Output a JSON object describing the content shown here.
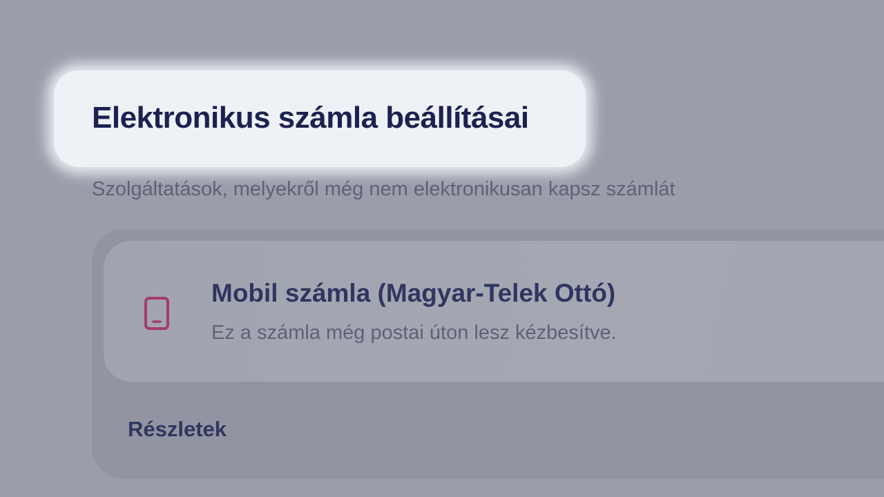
{
  "header": {
    "title": "Elektronikus számla beállításai",
    "subtitle": "Szolgáltatások, melyekről még nem elektronikusan kapsz számlát"
  },
  "service_card": {
    "icon": "mobile-phone-icon",
    "title": "Mobil számla (Magyar-Telek Ottó)",
    "description": "Ez a számla még postai úton lesz kézbesítve.",
    "details_label": "Részletek"
  },
  "colors": {
    "title": "#1b2150",
    "accent_icon": "#a33c6d",
    "highlight": "#eef2f6",
    "overlay": "#9b9eaa"
  }
}
